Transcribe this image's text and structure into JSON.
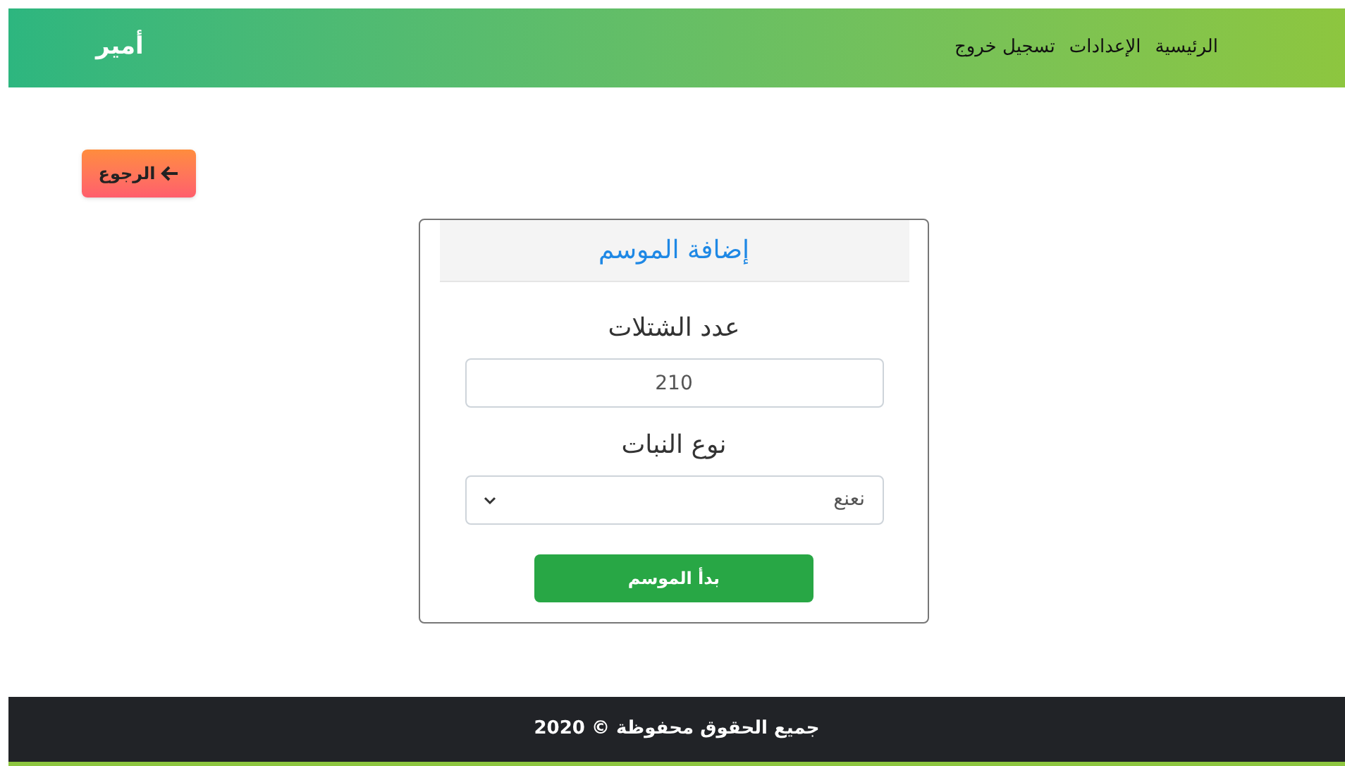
{
  "navbar": {
    "brand": "أمير",
    "links": [
      {
        "label": "الرئيسية"
      },
      {
        "label": "الإعدادات"
      },
      {
        "label": "تسجيل خروج"
      }
    ]
  },
  "back_button": {
    "label": "الرجوع"
  },
  "form": {
    "title": "إضافة الموسم",
    "fields": [
      {
        "kind": "input",
        "label": "عدد الشتلات",
        "value": "210"
      },
      {
        "kind": "select",
        "label": "نوع النبات",
        "value": "نعنع"
      }
    ],
    "submit": "بدأ الموسم"
  },
  "footer": "جميع الحقوق محفوظة © 2020"
}
